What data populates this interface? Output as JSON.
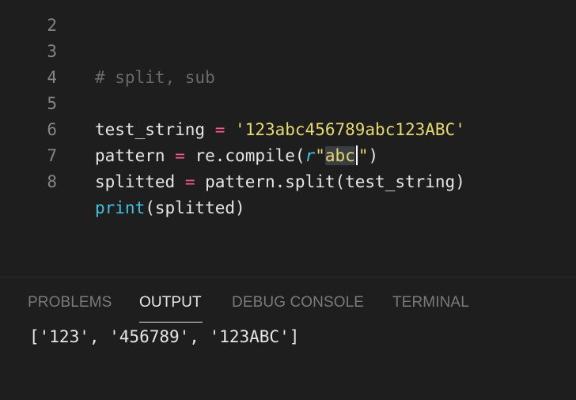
{
  "editor": {
    "lines": [
      {
        "number": "2"
      },
      {
        "number": "3",
        "comment": "# split, sub"
      },
      {
        "number": "4"
      },
      {
        "number": "5",
        "var": "test_string",
        "eq": "=",
        "str": "'123abc456789abc123ABC'"
      },
      {
        "number": "6",
        "var": "pattern",
        "eq": "=",
        "call": "re.compile(",
        "prefix": "r",
        "q1": "\"",
        "sel": "abc",
        "q2": "\"",
        "close": ")"
      },
      {
        "number": "7",
        "var": "splitted",
        "eq": "=",
        "call": "pattern.split(test_string)"
      },
      {
        "number": "8",
        "builtin": "print",
        "args": "(splitted)"
      }
    ]
  },
  "panel": {
    "tabs": [
      {
        "label": "PROBLEMS",
        "active": false
      },
      {
        "label": "OUTPUT",
        "active": true
      },
      {
        "label": "DEBUG CONSOLE",
        "active": false
      },
      {
        "label": "TERMINAL",
        "active": false
      }
    ],
    "output_text": "['123', '456789', '123ABC']"
  },
  "colors": {
    "background": "#1e1e1e",
    "keyword_operator": "#ff5c8d",
    "string": "#e6d96e",
    "builtin": "#3fc2e6",
    "comment": "#6a6a6a"
  }
}
